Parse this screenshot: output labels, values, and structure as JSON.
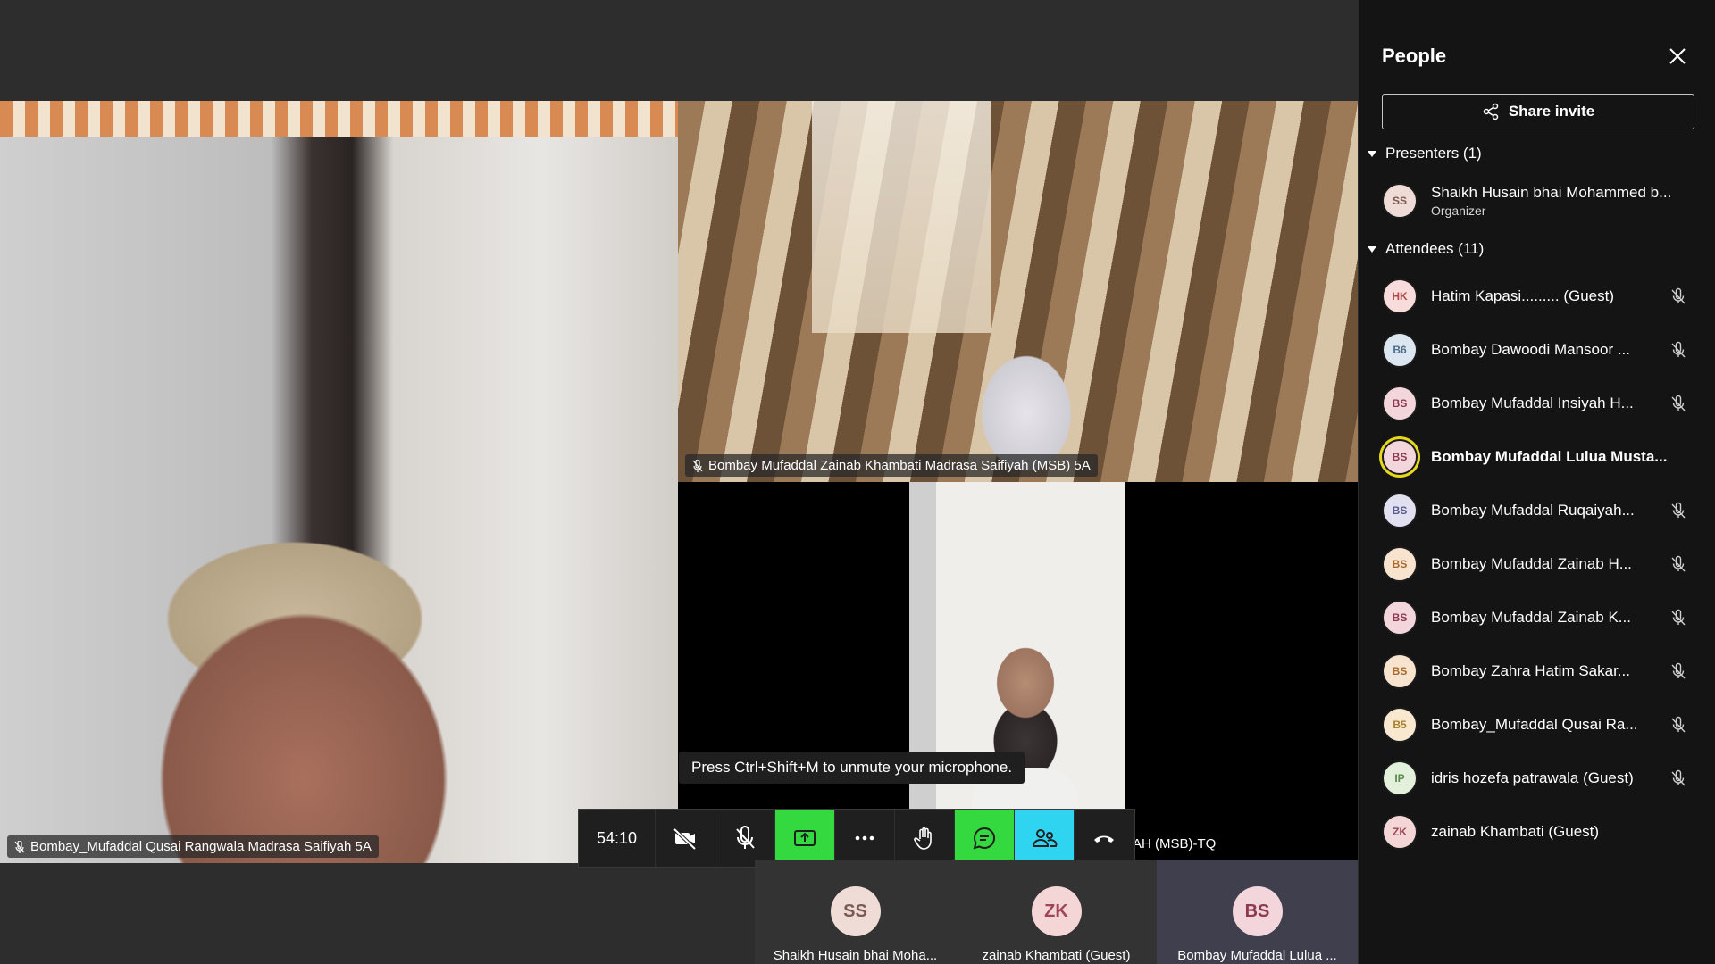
{
  "videos": {
    "main_left_name": "Bombay_Mufaddal Qusai Rangwala Madrasa Saifiyah 5A",
    "top_right_name": "Bombay Mufaddal Zainab Khambati Madrasa Saifiyah (MSB) 5A",
    "bottom_right_name_partial": "AH (MSB)-TQ"
  },
  "tooltip": "Press Ctrl+Shift+M to unmute your microphone.",
  "controls": {
    "timer": "54:10",
    "icons": [
      "camera-off-icon",
      "mic-off-icon",
      "share-tray-icon",
      "more-icon",
      "raise-hand-icon",
      "chat-icon",
      "people-icon",
      "hang-up-icon"
    ]
  },
  "strip": [
    {
      "initials": "SS",
      "name": "Shaikh Husain bhai Moha...",
      "bg": "#f0dcd7",
      "fg": "#7a5a52"
    },
    {
      "initials": "ZK",
      "name": "zainab Khambati (Guest)",
      "bg": "#f5d6d6",
      "fg": "#a0455a"
    },
    {
      "initials": "BS",
      "name": "Bombay Mufaddal Lulua ...",
      "bg": "#f3d6dc",
      "fg": "#8c3b4f"
    }
  ],
  "panel": {
    "title": "People",
    "share_label": "Share invite",
    "presenters_label": "Presenters (1)",
    "attendees_label": "Attendees (11)",
    "presenters": [
      {
        "initials": "SS",
        "name": "Shaikh Husain bhai Mohammed b...",
        "role": "Organizer",
        "bg": "#f0dcd7",
        "fg": "#7a5a52"
      }
    ],
    "attendees": [
      {
        "initials": "HK",
        "name": "Hatim Kapasi......... (Guest)",
        "bg": "#f8dcdc",
        "fg": "#b14a4a",
        "muted": true
      },
      {
        "initials": "B6",
        "name": "Bombay Dawoodi Mansoor ...",
        "bg": "#dbe6f0",
        "fg": "#4d6d8a",
        "muted": true
      },
      {
        "initials": "BS",
        "name": "Bombay Mufaddal Insiyah H...",
        "bg": "#f3d6dc",
        "fg": "#8c3b4f",
        "muted": true
      },
      {
        "initials": "BS",
        "name": "Bombay Mufaddal Lulua Musta...",
        "bg": "#f3d6dc",
        "fg": "#8c3b4f",
        "muted": false,
        "speaking": true
      },
      {
        "initials": "BS",
        "name": "Bombay Mufaddal Ruqaiyah...",
        "bg": "#e0e0f0",
        "fg": "#5a5a8c",
        "muted": true
      },
      {
        "initials": "BS",
        "name": "Bombay Mufaddal Zainab H...",
        "bg": "#f8e3cf",
        "fg": "#a86a2e",
        "muted": true
      },
      {
        "initials": "BS",
        "name": "Bombay Mufaddal Zainab K...",
        "bg": "#f3d6dc",
        "fg": "#8c3b4f",
        "muted": true
      },
      {
        "initials": "BS",
        "name": "Bombay Zahra Hatim Sakar...",
        "bg": "#f8e3cf",
        "fg": "#a86a2e",
        "muted": true
      },
      {
        "initials": "B5",
        "name": "Bombay_Mufaddal Qusai Ra...",
        "bg": "#f8e8cf",
        "fg": "#a8802e",
        "muted": true
      },
      {
        "initials": "IP",
        "name": "idris hozefa patrawala (Guest)",
        "bg": "#e3f0dc",
        "fg": "#5a8a4d",
        "muted": true
      },
      {
        "initials": "ZK",
        "name": "zainab Khambati (Guest)",
        "bg": "#f5d6d6",
        "fg": "#a0455a",
        "muted": false
      }
    ]
  }
}
